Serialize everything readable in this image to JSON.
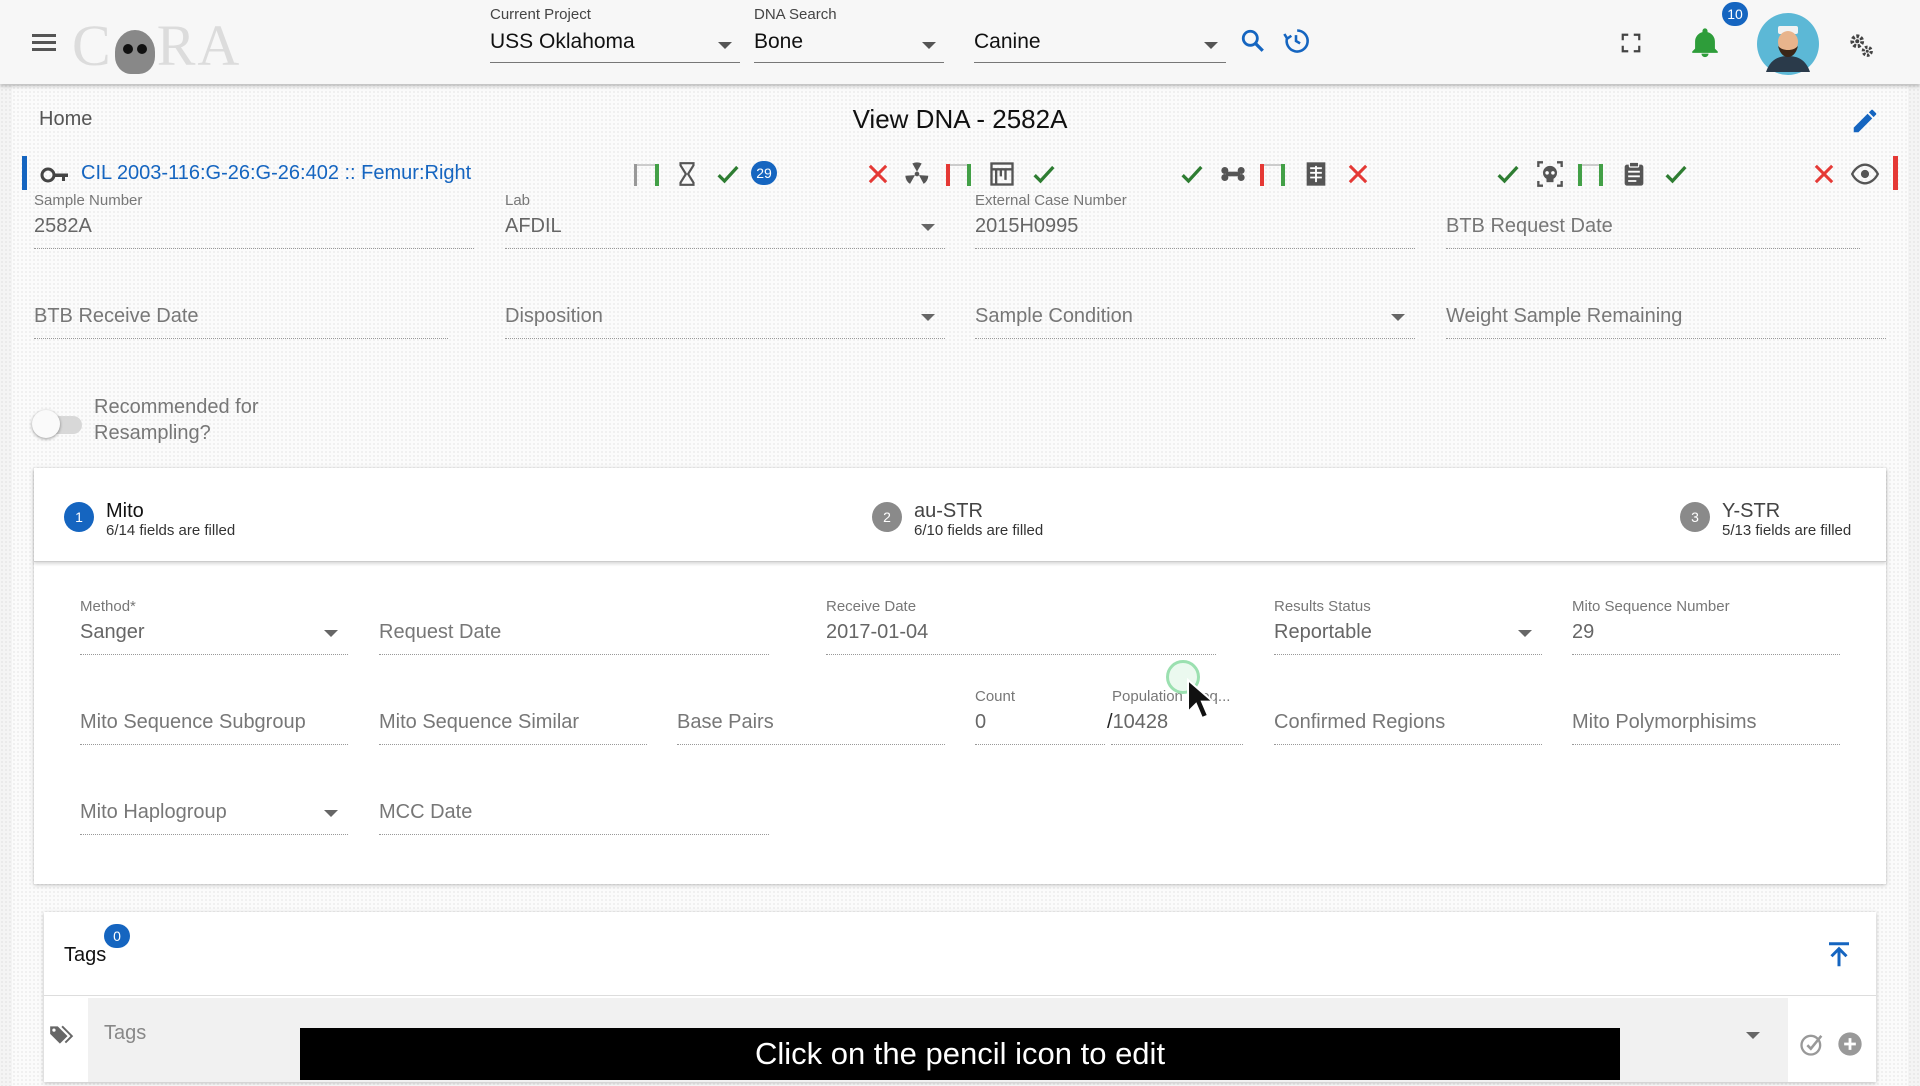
{
  "header": {
    "logo_text": "CORA",
    "project": {
      "label": "Current Project",
      "value": "USS Oklahoma"
    },
    "dna_search": {
      "label": "DNA Search",
      "value": "Bone"
    },
    "species": {
      "value": "Canine"
    },
    "notifications_count": "10"
  },
  "page": {
    "breadcrumb": "Home",
    "title": "View DNA - 2582A",
    "sample_id_link": "CIL 2003-116:G-26:G-26:402 :: Femur:Right",
    "status_badge": "29"
  },
  "sample_fields": {
    "sample_number": {
      "label": "Sample Number",
      "value": "2582A"
    },
    "lab": {
      "label": "Lab",
      "value": "AFDIL"
    },
    "external_case": {
      "label": "External Case Number",
      "value": "2015H0995"
    },
    "btb_request": {
      "placeholder": "BTB Request Date"
    },
    "btb_receive": {
      "placeholder": "BTB Receive Date"
    },
    "disposition": {
      "placeholder": "Disposition"
    },
    "sample_condition": {
      "placeholder": "Sample Condition"
    },
    "weight_remaining": {
      "placeholder": "Weight Sample Remaining"
    },
    "resampling_label_1": "Recommended for",
    "resampling_label_2": "Resampling?"
  },
  "steps": [
    {
      "num": "1",
      "name": "Mito",
      "sub": "6/14 fields are filled"
    },
    {
      "num": "2",
      "name": "au-STR",
      "sub": "6/10 fields are filled"
    },
    {
      "num": "3",
      "name": "Y-STR",
      "sub": "5/13 fields are filled"
    }
  ],
  "mito": {
    "method": {
      "label": "Method*",
      "value": "Sanger"
    },
    "request_date": {
      "placeholder": "Request Date"
    },
    "receive_date": {
      "label": "Receive Date",
      "value": "2017-01-04"
    },
    "results_status": {
      "label": "Results Status",
      "value": "Reportable"
    },
    "seq_number": {
      "label": "Mito Sequence Number",
      "value": "29"
    },
    "seq_subgroup": {
      "placeholder": "Mito Sequence Subgroup"
    },
    "seq_similar": {
      "placeholder": "Mito Sequence Similar"
    },
    "base_pairs": {
      "placeholder": "Base Pairs"
    },
    "count": {
      "label": "Count",
      "value": "0"
    },
    "population": {
      "label": "Population Freq...",
      "value": "10428"
    },
    "population_sep": "/",
    "confirmed_regions": {
      "placeholder": "Confirmed Regions"
    },
    "polymorphisms": {
      "placeholder": "Mito Polymorphisims"
    },
    "haplogroup": {
      "placeholder": "Mito Haplogroup"
    },
    "mcc_date": {
      "placeholder": "MCC Date"
    }
  },
  "tags": {
    "title": "Tags",
    "count": "0",
    "placeholder": "Tags"
  },
  "caption": "Click on the pencil icon to edit",
  "colors": {
    "accent": "#1565c0",
    "success": "#2e7d32",
    "danger": "#e53935",
    "bell": "#2e9d3a"
  }
}
